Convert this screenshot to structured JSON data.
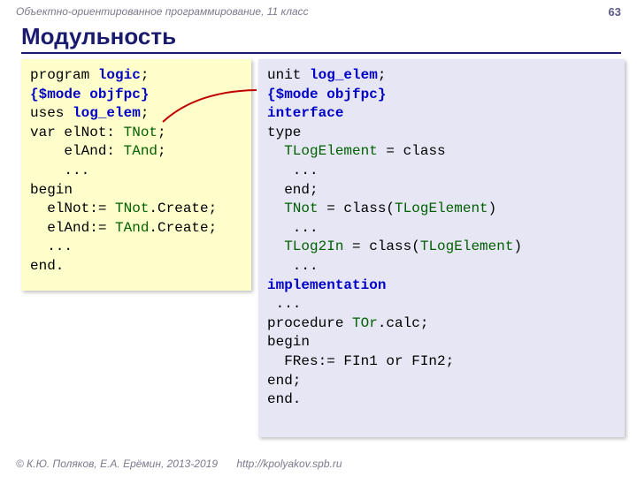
{
  "header": {
    "subtitle": "Объектно-ориентированное программирование, 11 класс",
    "page": "63"
  },
  "title": "Модульность",
  "code_left": {
    "l1a": "program",
    "l1b": " logic",
    "l1c": ";",
    "l2": "{$mode objfpc}",
    "l3a": "uses ",
    "l3b": "log_elem",
    "l3c": ";",
    "l4a": "var elNot: ",
    "l4b": "TNot",
    "l4c": ";",
    "l5a": "    elAnd: ",
    "l5b": "TAnd",
    "l5c": ";",
    "l6": "    ...",
    "l7": "begin",
    "l8a": "  elNot:= ",
    "l8b": "TNot",
    "l8c": ".Create;",
    "l9a": "  elAnd:= ",
    "l9b": "TAnd",
    "l9c": ".Create;",
    "l10": "  ...",
    "l11": "end."
  },
  "code_right": {
    "l1a": "unit ",
    "l1b": "log_elem",
    "l1c": ";",
    "l2": "{$mode objfpc}",
    "l3": "interface",
    "l4": "type",
    "l5a": "  ",
    "l5b": "TLogElement",
    "l5c": " = class",
    "l6": "   ...",
    "l7": "  end;",
    "l8a": "  ",
    "l8b": "TNot",
    "l8c": " = class(",
    "l8d": "TLogElement",
    "l8e": ")",
    "l9": "   ...",
    "l10a": "  ",
    "l10b": "TLog2In",
    "l10c": " = class(",
    "l10d": "TLogElement",
    "l10e": ")",
    "l11": "   ...",
    "l12": "implementation",
    "l13": " ...",
    "l14a": "procedure ",
    "l14b": "TOr",
    "l14c": ".calc;",
    "l15": "begin",
    "l16": "  FRes:= FIn1 or FIn2;",
    "l17": "end;",
    "l18": "end."
  },
  "footer": {
    "copyright": "© К.Ю. Поляков, Е.А. Ерёмин, 2013-2019",
    "url": "http://kpolyakov.spb.ru"
  }
}
